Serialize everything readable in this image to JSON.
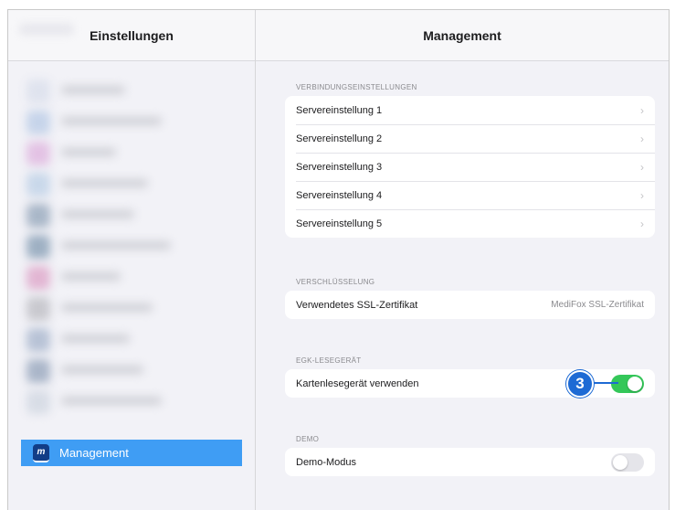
{
  "sidebar": {
    "title": "Einstellungen",
    "selected_label": "Management",
    "selected_icon_text": "m",
    "blurred_icon_colors": [
      "#dfe3ee",
      "#c6d4ea",
      "#e3c2e4",
      "#c9d8ea",
      "#a9b7c8",
      "#9eb0c3",
      "#e2b6d3",
      "#c9c9cf",
      "#b8c3d6",
      "#aab6c9",
      "#d8dde6",
      "#bfe8ee",
      "#f2b5b5",
      "#f5d5b8",
      "#d0d0d8",
      "#b8bcc8"
    ]
  },
  "main": {
    "title": "Management",
    "sections": [
      {
        "title": "VERBINDUNGSEINSTELLUNGEN",
        "rows": [
          {
            "label": "Servereinstellung 1",
            "chevron": "›"
          },
          {
            "label": "Servereinstellung 2",
            "chevron": "›"
          },
          {
            "label": "Servereinstellung 3",
            "chevron": "›"
          },
          {
            "label": "Servereinstellung 4",
            "chevron": "›"
          },
          {
            "label": "Servereinstellung 5",
            "chevron": "›"
          }
        ]
      },
      {
        "title": "VERSCHLÜSSELUNG",
        "rows": [
          {
            "label": "Verwendetes SSL-Zertifikat",
            "value": "MediFox SSL-Zertifikat"
          }
        ]
      },
      {
        "title": "EGK-LESEGERÄT",
        "rows": [
          {
            "label": "Kartenlesegerät verwenden",
            "toggle": true
          }
        ]
      },
      {
        "title": "DEMO",
        "rows": [
          {
            "label": "Demo-Modus",
            "toggle": false
          }
        ]
      }
    ]
  },
  "callout": {
    "number": "3",
    "color": "#1d6ad4"
  },
  "colors": {
    "accent": "#3f9df4",
    "toggle_on": "#34c759",
    "toggle_off": "#e5e5ea"
  }
}
